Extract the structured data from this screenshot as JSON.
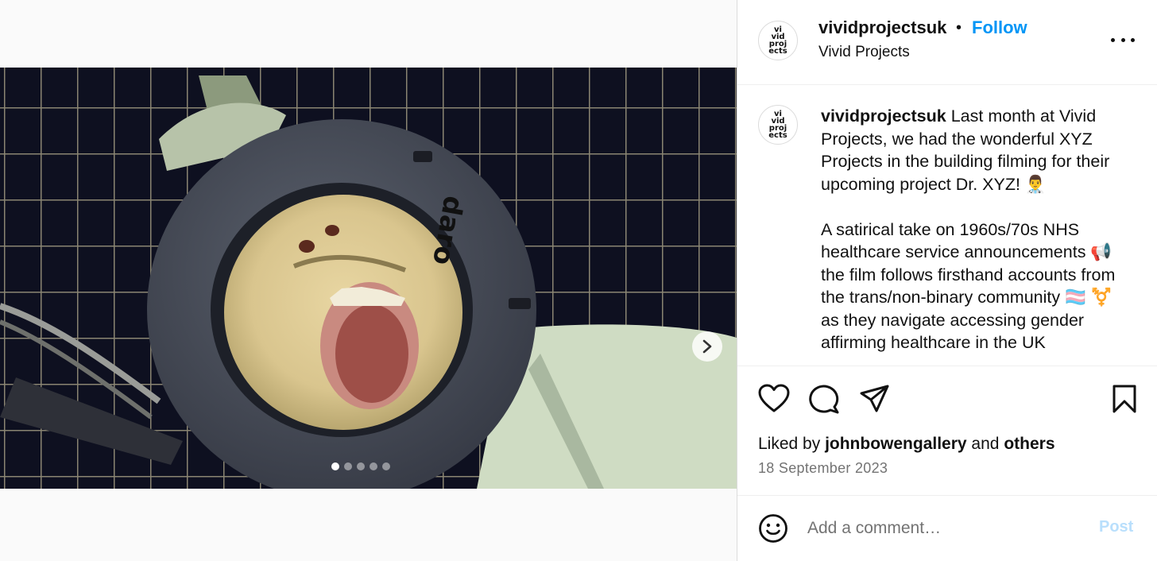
{
  "post": {
    "username": "vividprojectsuk",
    "separator": "•",
    "follow_label": "Follow",
    "subtitle": "Vivid Projects",
    "avatar_text": [
      "vi",
      "vid",
      "proj",
      "ects"
    ],
    "caption_text": " Last month at Vivid Projects, we had the wonderful XYZ Projects in the building filming for their upcoming project Dr. XYZ! 👨‍⚕️\n\nA satirical take on 1960s/70s NHS healthcare service announcements 📢 the film follows firsthand accounts from the trans/non-binary community 🏳️‍⚧️ ⚧️ as they navigate accessing gender affirming healthcare in the UK"
  },
  "media": {
    "slide_count": 5,
    "active_slide": 1,
    "next_icon": "chevron-right-icon"
  },
  "actions": {
    "icons": [
      "heart-icon",
      "comment-icon",
      "share-icon",
      "bookmark-icon"
    ]
  },
  "likes": {
    "prefix": "Liked by ",
    "user": "johnbowengallery",
    "middle": " and ",
    "others": "others"
  },
  "date": "18 September 2023",
  "comment": {
    "placeholder": "Add a comment…",
    "post_label": "Post",
    "emoji_icon": "smiley-icon"
  },
  "colors": {
    "link_blue": "#0095f6",
    "post_disabled": "#b9dffc",
    "muted": "#737373"
  }
}
